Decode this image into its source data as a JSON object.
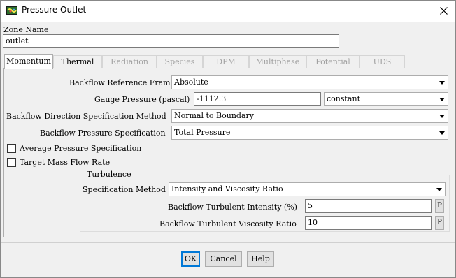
{
  "window": {
    "title": "Pressure Outlet",
    "icon": "fluent-app-icon",
    "close_icon": "close-icon"
  },
  "zone": {
    "label": "Zone Name",
    "value": "outlet"
  },
  "tabs": [
    {
      "label": "Momentum",
      "state": "active"
    },
    {
      "label": "Thermal",
      "state": "enabled"
    },
    {
      "label": "Radiation",
      "state": "disabled"
    },
    {
      "label": "Species",
      "state": "disabled"
    },
    {
      "label": "DPM",
      "state": "disabled"
    },
    {
      "label": "Multiphase",
      "state": "disabled"
    },
    {
      "label": "Potential",
      "state": "disabled"
    },
    {
      "label": "UDS",
      "state": "disabled"
    }
  ],
  "momentum": {
    "backflow_ref_frame": {
      "label": "Backflow Reference Frame",
      "value": "Absolute"
    },
    "gauge_pressure": {
      "label": "Gauge Pressure (pascal)",
      "value": "-1112.3",
      "method": "constant"
    },
    "backflow_direction": {
      "label": "Backflow Direction Specification Method",
      "value": "Normal to Boundary"
    },
    "backflow_pressure": {
      "label": "Backflow Pressure Specification",
      "value": "Total Pressure"
    },
    "avg_pressure": {
      "label": "Average Pressure Specification",
      "checked": false
    },
    "target_mass_flow": {
      "label": "Target Mass Flow Rate",
      "checked": false
    },
    "turbulence": {
      "group_label": "Turbulence",
      "spec_method": {
        "label": "Specification Method",
        "value": "Intensity and Viscosity Ratio"
      },
      "intensity": {
        "label": "Backflow Turbulent Intensity (%)",
        "value": "5",
        "param_button": "P"
      },
      "viscosity_ratio": {
        "label": "Backflow Turbulent Viscosity Ratio",
        "value": "10",
        "param_button": "P"
      }
    }
  },
  "buttons": {
    "ok": "OK",
    "cancel": "Cancel",
    "help": "Help"
  },
  "colors": {
    "default_button_border": "#0078d7",
    "window_bg": "#f0f0f0"
  }
}
